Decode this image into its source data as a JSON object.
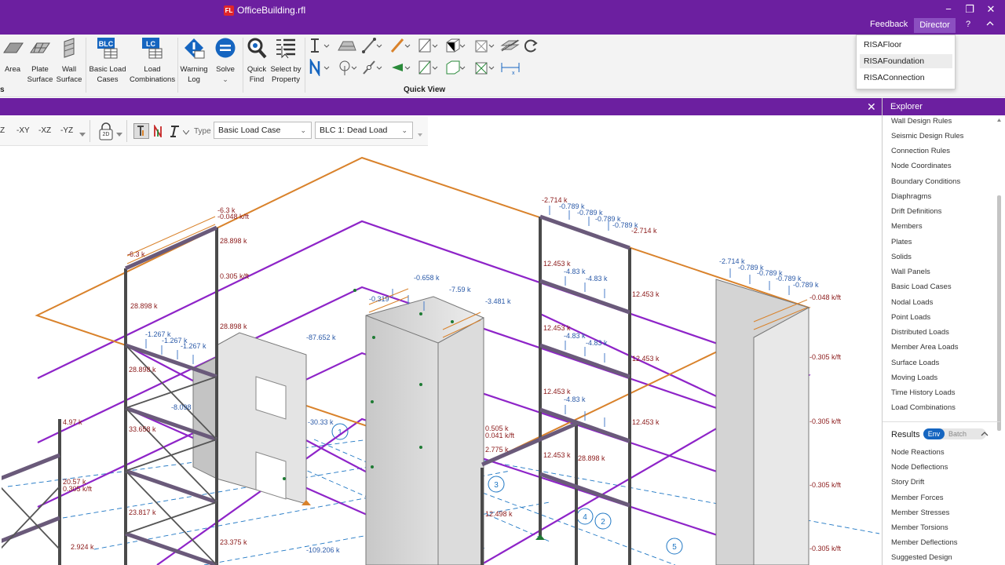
{
  "window": {
    "title": "OfficeBuilding.rfl",
    "logo_text": "FL",
    "feedback_label": "Feedback",
    "director_label": "Director",
    "help_label": "?",
    "collapse_label": "^",
    "min_label": "−",
    "restore_label": "❐",
    "close_label": "✕"
  },
  "ribbon": {
    "group_left_label": "s",
    "buttons": [
      {
        "label": "Area",
        "icon": "area-icon"
      },
      {
        "label": "Plate Surface",
        "icon": "plate-surface-icon"
      },
      {
        "label": "Wall Surface",
        "icon": "wall-surface-icon"
      },
      {
        "label": "Basic Load Cases",
        "icon": "blc-icon",
        "badge": "BLC"
      },
      {
        "label": "Load Combinations",
        "icon": "lc-icon",
        "badge": "LC"
      },
      {
        "label": "Warning Log",
        "icon": "warning-icon"
      },
      {
        "label": "Solve",
        "icon": "solve-icon"
      },
      {
        "label": "Quick Find",
        "icon": "magnifier-icon"
      },
      {
        "label": "Select by Property",
        "icon": "select-property-icon"
      }
    ],
    "quick_view_label": "Quick View"
  },
  "director_menu": {
    "items": [
      "RISAFloor",
      "RISAFoundation",
      "RISAConnection"
    ],
    "highlighted": "RISAFoundation"
  },
  "view_toolbar": {
    "view_buttons": [
      "-XY",
      "-XZ",
      "-YZ"
    ],
    "partial_label": "Z",
    "mode_badge": "2D",
    "type_label": "Type",
    "type_value": "Basic Load Case",
    "case_value": "BLC 1: Dead Load"
  },
  "explorer": {
    "title": "Explorer",
    "items": [
      "Wall Design Rules",
      "Seismic Design Rules",
      "Connection Rules",
      "Node Coordinates",
      "Boundary Conditions",
      "Diaphragms",
      "Drift Definitions",
      "Members",
      "Plates",
      "Solids",
      "Wall Panels",
      "Basic Load Cases",
      "Nodal Loads",
      "Point Loads",
      "Distributed Loads",
      "Member Area Loads",
      "Surface Loads",
      "Moving Loads",
      "Time History Loads",
      "Load Combinations"
    ],
    "results_label": "Results",
    "env_label": "Env",
    "batch_label": "Batch",
    "results_items": [
      "Node Reactions",
      "Node Deflections",
      "Story Drift",
      "Member Forces",
      "Member Stresses",
      "Member Torsions",
      "Member Deflections",
      "Suggested Design"
    ]
  },
  "model_labels": {
    "l_6_3k": "-6.3 k",
    "l_048": "-0.048 k/ft",
    "l_28898": "28.898 k",
    "l_0305": "0.305 k/ft",
    "l_1267": "-1.267 k",
    "l_87652": "-87.652 k",
    "l_3033": "-30.33 k",
    "l_109206": "-109.206 k",
    "l_23375": "23.375 k",
    "l_2924": "2.924 k",
    "l_4_97": "4.97 k",
    "l_0658": "-0.658 k",
    "l_0319": "-0.319",
    "l_759": "-7.59 k",
    "l_3481": "-3.481 k",
    "l_2714": "-2.714 k",
    "l_0789": "-0.789 k",
    "l_12453": "12.453 k",
    "l_483": "-4.83 k",
    "l_m0305": "-0.305 k/ft",
    "l_2057": "20.57 k",
    "l_33658": "33.658 k",
    "l_23817": "23.817 k",
    "l_8098": "-8.098",
    "l_0041": "0.041 k/ft",
    "l_2775": "2.775 k",
    "l_12498": "12.498 k",
    "l_0505": "0.505 k",
    "grid_1": "1",
    "grid_2": "2",
    "grid_3": "3",
    "grid_4": "4",
    "grid_5": "5"
  }
}
